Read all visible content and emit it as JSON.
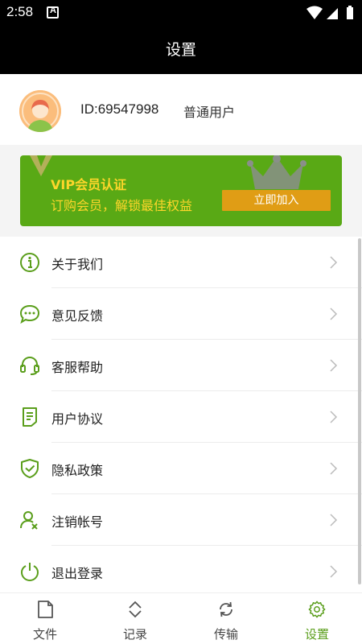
{
  "status_bar": {
    "time": "2:58"
  },
  "header": {
    "title": "设置"
  },
  "profile": {
    "id_text": "ID:69547998",
    "user_type": "普通用户"
  },
  "vip": {
    "title": "VIP会员认证",
    "subtitle": "订购会员，解锁最佳权益",
    "button": "立即加入"
  },
  "menu": {
    "items": [
      {
        "label": "关于我们",
        "icon": "info-icon"
      },
      {
        "label": "意见反馈",
        "icon": "chat-bubble-icon"
      },
      {
        "label": "客服帮助",
        "icon": "headset-icon"
      },
      {
        "label": "用户协议",
        "icon": "document-icon"
      },
      {
        "label": "隐私政策",
        "icon": "shield-check-icon"
      },
      {
        "label": "注销帐号",
        "icon": "user-remove-icon"
      },
      {
        "label": "退出登录",
        "icon": "power-icon"
      }
    ]
  },
  "tabbar": {
    "tabs": [
      {
        "label": "文件",
        "icon": "file-icon"
      },
      {
        "label": "记录",
        "icon": "sort-icon"
      },
      {
        "label": "传输",
        "icon": "sync-icon"
      },
      {
        "label": "设置",
        "icon": "gear-icon"
      }
    ],
    "active_index": 3
  },
  "colors": {
    "accent_green": "#5a9e1b",
    "vip_green": "#59a915",
    "vip_gold": "#fdd62a",
    "vip_button": "#e09d15"
  }
}
